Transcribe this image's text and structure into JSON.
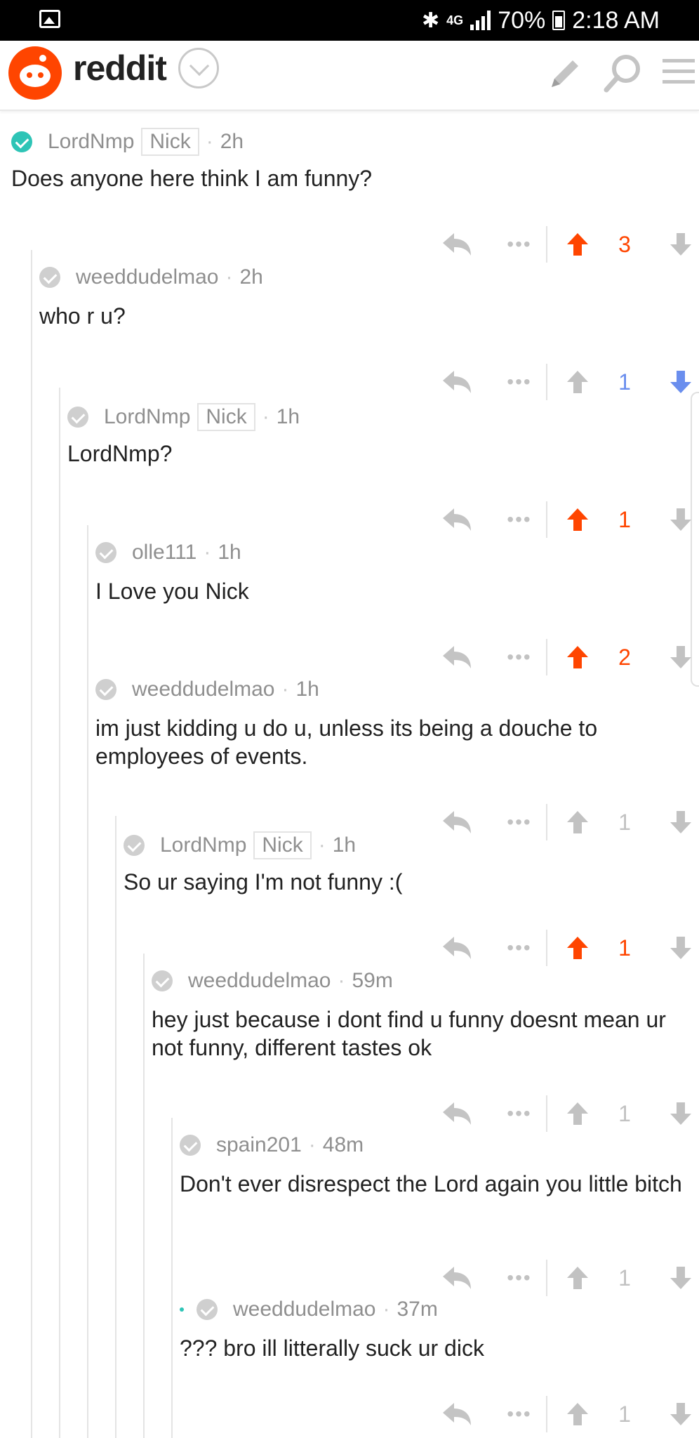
{
  "status_bar": {
    "network": "4G",
    "battery": "70%",
    "time": "2:18 AM"
  },
  "app": {
    "name": "reddit"
  },
  "colors": {
    "upvoted": "#ff4500",
    "downvoted": "#6a8eee",
    "neutral": "#c2c2c2",
    "mod_check": "#2ec4b6"
  },
  "comments": [
    {
      "author": "LordNmp",
      "flair": "Nick",
      "time": "2h",
      "text": "Does anyone here think I am funny?",
      "score": "3",
      "vote": "up",
      "depth": 0,
      "mod": true
    },
    {
      "author": "weeddudelmao",
      "flair": "",
      "time": "2h",
      "text": "who r u?",
      "score": "1",
      "vote": "down",
      "depth": 1
    },
    {
      "author": "LordNmp",
      "flair": "Nick",
      "time": "1h",
      "text": "LordNmp?",
      "score": "1",
      "vote": "up",
      "depth": 2
    },
    {
      "author": "olle111",
      "flair": "",
      "time": "1h",
      "text": "I Love you Nick",
      "score": "2",
      "vote": "up",
      "depth": 3
    },
    {
      "author": "weeddudelmao",
      "flair": "",
      "time": "1h",
      "text": "im just kidding u do u, unless its being a douche to employees of events.",
      "score": "1",
      "vote": "none",
      "depth": 3
    },
    {
      "author": "LordNmp",
      "flair": "Nick",
      "time": "1h",
      "text": "So ur saying I'm not funny :(",
      "score": "1",
      "vote": "up",
      "depth": 4
    },
    {
      "author": "weeddudelmao",
      "flair": "",
      "time": "59m",
      "text": "hey just because i dont find u funny doesnt mean ur not funny, different tastes ok",
      "score": "1",
      "vote": "none",
      "depth": 5
    },
    {
      "author": "spain201",
      "flair": "",
      "time": "48m",
      "text": "Don't ever disrespect the Lord again you little bitch",
      "score": "1",
      "vote": "none",
      "depth": 6
    },
    {
      "author": "weeddudelmao",
      "flair": "",
      "time": "37m",
      "text": "??? bro ill litterally suck ur dick",
      "score": "1",
      "vote": "none",
      "depth": 6,
      "new": true
    }
  ]
}
